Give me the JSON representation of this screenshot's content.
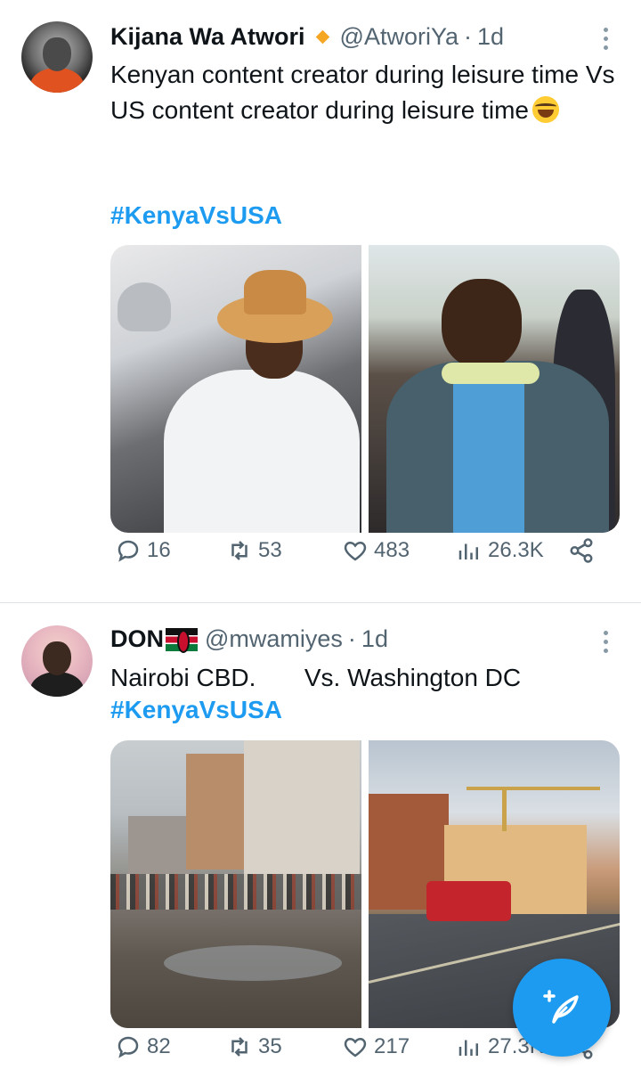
{
  "tweets": [
    {
      "author": {
        "display_name": "Kijana Wa Atwori",
        "handle": "@AtworiYa",
        "badge": "verified-orange-diamond"
      },
      "time": "1d",
      "separator": "·",
      "text": "Kenyan content creator during leisure time Vs US content creator during leisure time",
      "emoji": "tears-of-joy-emoji",
      "hashtag": "#KenyaVsUSA",
      "media": [
        "man-in-car-with-hat-photo",
        "man-eating-corn-photo"
      ],
      "stats": {
        "replies": "16",
        "reposts": "53",
        "likes": "483",
        "views": "26.3K"
      }
    },
    {
      "author": {
        "display_name": "DON",
        "handle": "@mwamiyes",
        "flag": "kenya-flag"
      },
      "time": "1d",
      "separator": "·",
      "text": "Nairobi CBD.       Vs. Washington DC",
      "hashtag": "#KenyaVsUSA",
      "media": [
        "nairobi-street-photo",
        "washington-dc-street-photo"
      ],
      "stats": {
        "replies": "82",
        "reposts": "35",
        "likes": "217",
        "views": "27.3K"
      }
    }
  ],
  "fab": {
    "icon": "compose-post-icon"
  },
  "colors": {
    "accent": "#1d9bf0",
    "text": "#0f1419",
    "secondary": "#536471",
    "badge": "#f5a623"
  }
}
